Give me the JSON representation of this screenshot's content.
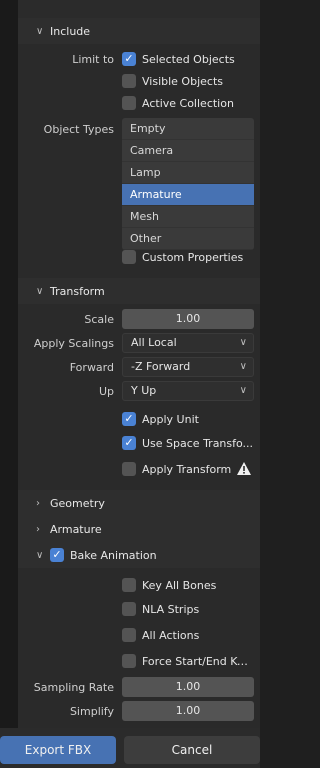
{
  "include": {
    "header": "Include",
    "limit_to_label": "Limit to",
    "selected_objects": "Selected Objects",
    "visible_objects": "Visible Objects",
    "active_collection": "Active Collection",
    "object_types_label": "Object Types",
    "object_types": [
      "Empty",
      "Camera",
      "Lamp",
      "Armature",
      "Mesh",
      "Other"
    ],
    "custom_properties": "Custom Properties"
  },
  "transform": {
    "header": "Transform",
    "scale_label": "Scale",
    "scale_value": "1.00",
    "apply_scalings_label": "Apply Scalings",
    "apply_scalings_value": "All Local",
    "forward_label": "Forward",
    "forward_value": "-Z Forward",
    "up_label": "Up",
    "up_value": "Y Up",
    "apply_unit": "Apply Unit",
    "use_space_transform": "Use Space Transfo...",
    "apply_transform": "Apply Transform"
  },
  "geometry": {
    "header": "Geometry"
  },
  "armature": {
    "header": "Armature"
  },
  "bake": {
    "header": "Bake Animation",
    "key_all_bones": "Key All Bones",
    "nla_strips": "NLA Strips",
    "all_actions": "All Actions",
    "force_start_end": "Force Start/End Ke...",
    "sampling_rate_label": "Sampling Rate",
    "sampling_rate_value": "1.00",
    "simplify_label": "Simplify",
    "simplify_value": "1.00"
  },
  "footer": {
    "export_label": "Export FBX",
    "cancel_label": "Cancel"
  },
  "colors": {
    "accent": "#4772b3",
    "checkbox_on": "#4a82d4",
    "panel_bg": "#2b2b2b",
    "warning": "#f0f0f0"
  }
}
